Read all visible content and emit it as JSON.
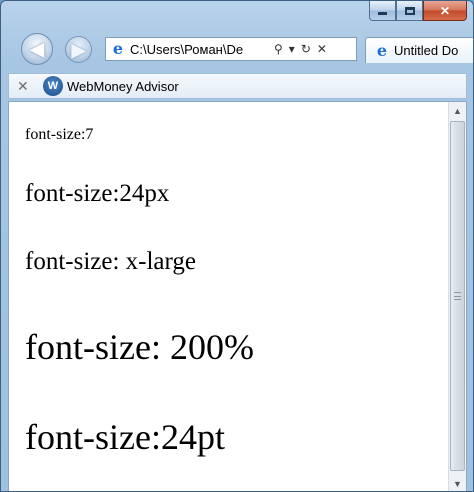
{
  "browser": {
    "address": "C:\\Users\\Роман\\De",
    "tab_title": "Untitled Do",
    "caption": {
      "minimize": "",
      "maximize": "",
      "close": "✕"
    },
    "nav": {
      "back": "◀",
      "forward": "▶"
    }
  },
  "toolbar": {
    "close_label": "✕",
    "addon_label": "WebMoney Advisor",
    "addon_icon": "webmoney-icon"
  },
  "page": {
    "lines": [
      "font-size:7",
      "font-size:24px",
      "font-size: x-large",
      "font-size: 200%",
      "font-size:24pt"
    ]
  },
  "colors": {
    "frame": "#a6c6e3",
    "close_button": "#c24a2c",
    "page_background": "#ffffff"
  }
}
